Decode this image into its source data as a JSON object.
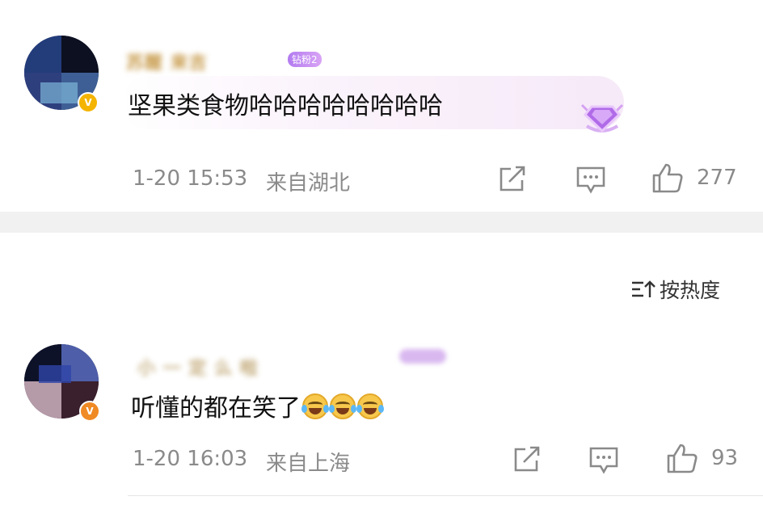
{
  "comments": [
    {
      "username": "苏醒  来吉",
      "fan_badge": "钻粉2",
      "text": "坚果类食物哈哈哈哈哈哈哈哈",
      "time": "1-20 15:53",
      "location": "来自湖北",
      "likes": "277",
      "verified_color": "#f4b400"
    },
    {
      "username": "  小  一  定  么  啦",
      "fan_badge": "",
      "text": "听懂的都在笑了",
      "emoji": [
        "laugh-cry-emoji",
        "laugh-cry-emoji",
        "laugh-cry-emoji"
      ],
      "time": "1-20 16:03",
      "location": "来自上海",
      "likes": "93",
      "verified_color": "#f08a24"
    }
  ],
  "sort": {
    "label": "按热度",
    "icon": "sort-icon"
  },
  "icons": {
    "share": "share-icon",
    "comment": "comment-icon",
    "like": "thumbs-up-icon"
  }
}
